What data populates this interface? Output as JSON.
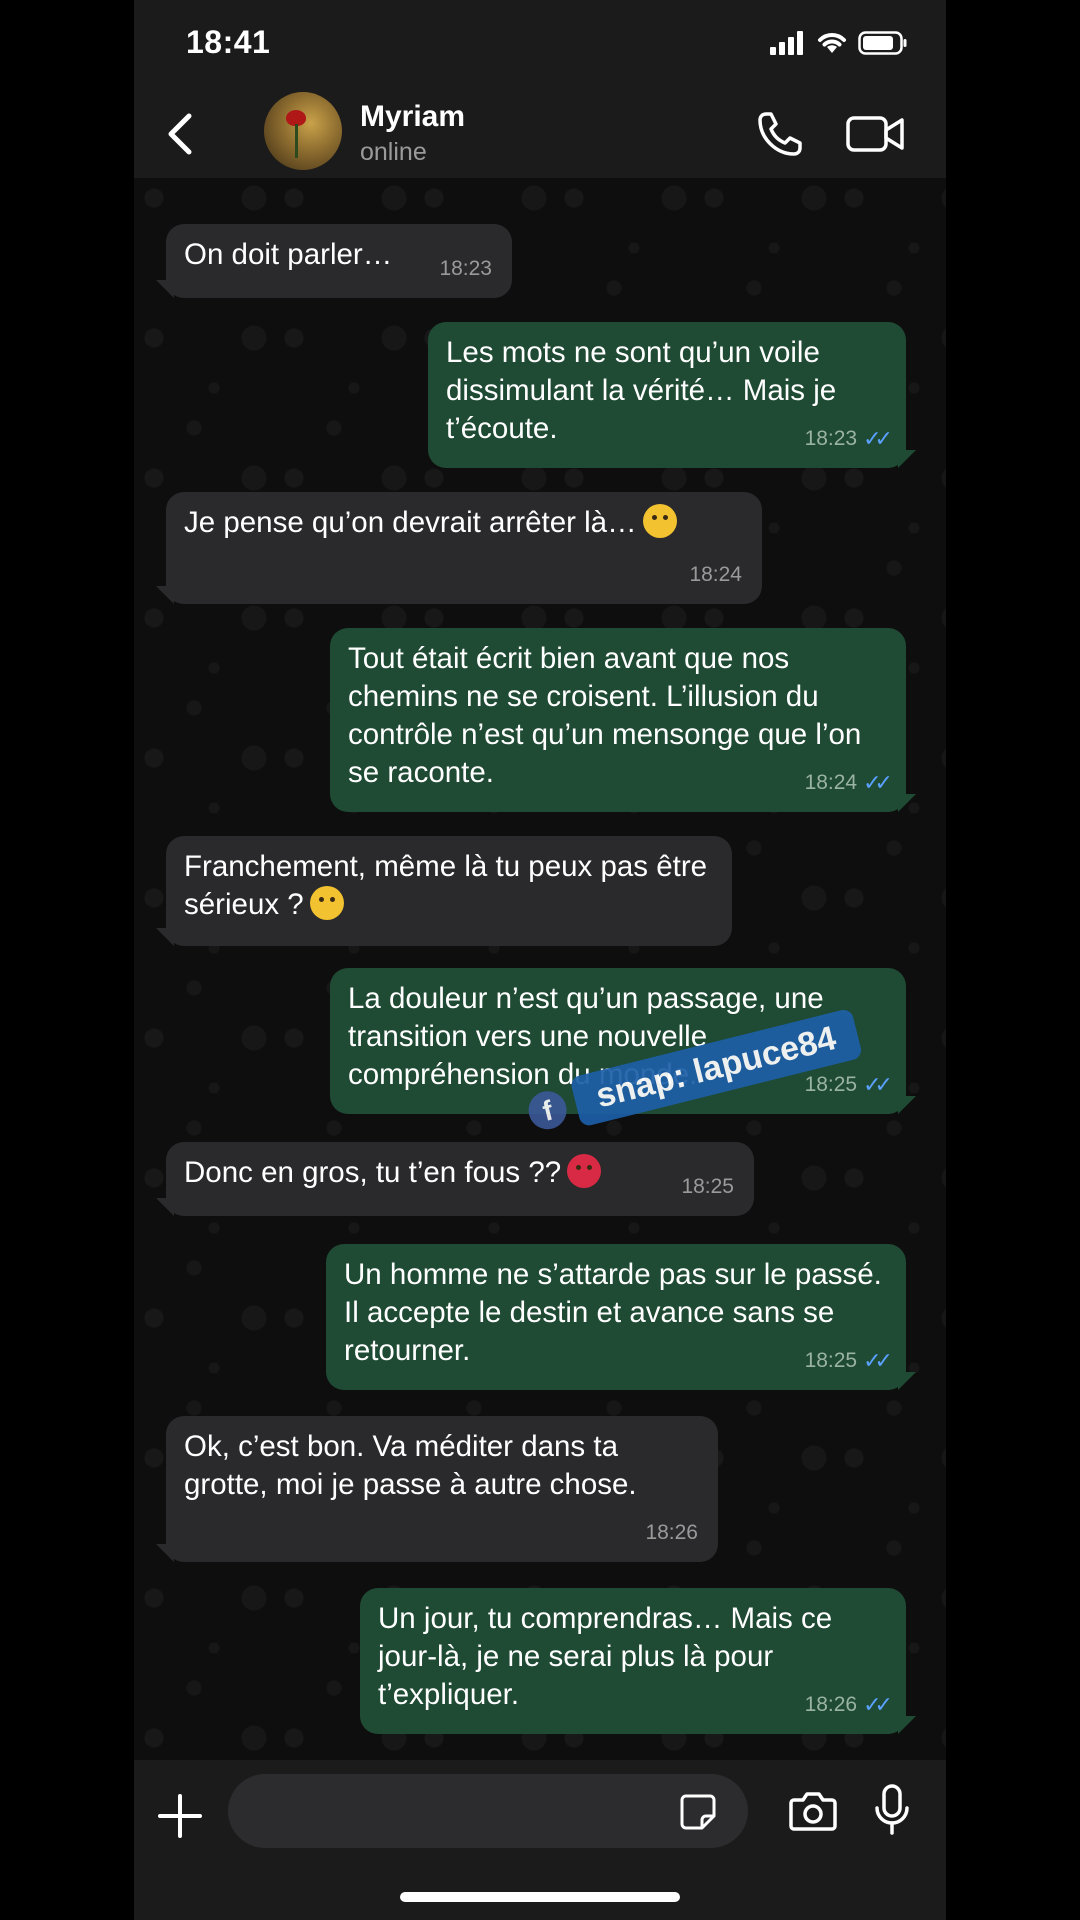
{
  "status_bar": {
    "time": "18:41"
  },
  "header": {
    "contact_name": "Myriam",
    "contact_status": "online"
  },
  "messages": [
    {
      "direction": "in",
      "text": "On doit parler…",
      "time": "18:23"
    },
    {
      "direction": "out",
      "text": "Les mots ne sont qu’un voile dissimulant la vérité… Mais je t’écoute.",
      "time": "18:23"
    },
    {
      "direction": "in",
      "text": "Je pense qu’on devrait arrêter là…",
      "emoji": "disappointed-face",
      "time": "18:24"
    },
    {
      "direction": "out",
      "text": "Tout était écrit bien avant que nos chemins ne se croisent. L’illusion du contrôle n’est qu’un mensonge que l’on se raconte.",
      "time": "18:24"
    },
    {
      "direction": "in",
      "text": "Franchement, même là tu peux pas être sérieux ?",
      "emoji": "loudly-crying-face"
    },
    {
      "direction": "out",
      "text": "La douleur n’est qu’un passage, une transition vers une nouvelle compréhension du monde.",
      "time": "18:25"
    },
    {
      "direction": "in",
      "text": "Donc en gros, tu t’en fous ??",
      "emoji": "angry-face",
      "time": "18:25"
    },
    {
      "direction": "out",
      "text": "Un homme ne s’attarde pas sur le passé. Il accepte le destin et avance sans se retourner.",
      "time": "18:25"
    },
    {
      "direction": "in",
      "text": "Ok, c’est bon. Va méditer dans ta grotte, moi je passe à autre chose.",
      "time": "18:26"
    },
    {
      "direction": "out",
      "text": "Un jour, tu comprendras… Mais ce jour-là, je ne serai plus là pour t’expliquer.",
      "time": "18:26"
    }
  ],
  "watermark": {
    "text": "snap: lapuce84",
    "icon": "facebook-icon"
  },
  "input_bar": {
    "placeholder": ""
  },
  "colors": {
    "incoming_bubble": "#2a2a2c",
    "outgoing_bubble": "#1f4a33",
    "read_ticks": "#5aa0ff",
    "watermark_bg": "#1d5fa8"
  }
}
